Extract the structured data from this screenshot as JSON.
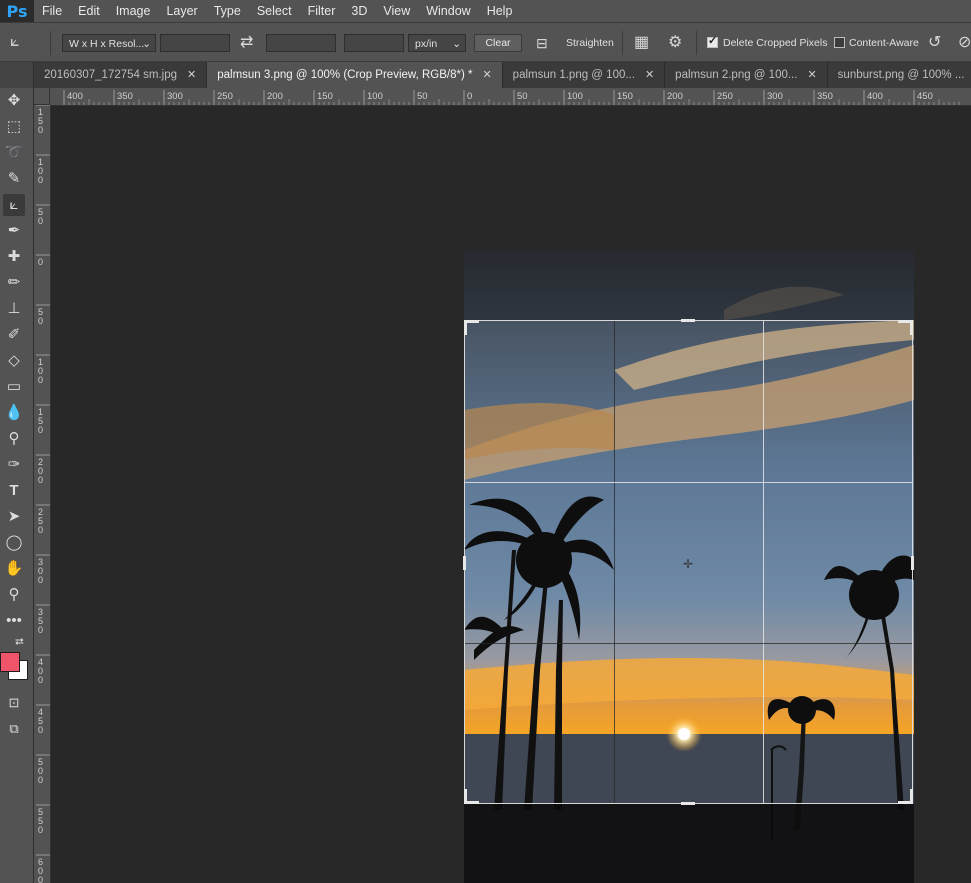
{
  "app": {
    "logo": "Ps"
  },
  "menu": [
    "File",
    "Edit",
    "Image",
    "Layer",
    "Type",
    "Select",
    "Filter",
    "3D",
    "View",
    "Window",
    "Help"
  ],
  "options": {
    "ratio_preset": "W x H x Resol...",
    "unit": "px/in",
    "clear_label": "Clear",
    "straighten_label": "Straighten",
    "delete_cropped_label": "Delete Cropped Pixels",
    "delete_cropped_checked": true,
    "content_aware_label": "Content-Aware",
    "content_aware_checked": false
  },
  "tabs": [
    {
      "label": "20160307_172754 sm.jpg",
      "active": false
    },
    {
      "label": "palmsun 3.png @ 100% (Crop Preview, RGB/8*) *",
      "active": true
    },
    {
      "label": "palmsun 1.png @ 100...",
      "active": false
    },
    {
      "label": "palmsun 2.png @ 100...",
      "active": false
    },
    {
      "label": "sunburst.png @ 100% ...",
      "active": false
    }
  ],
  "close_glyph": "✕",
  "ruler_top_labels": [
    "400",
    "350",
    "300",
    "250",
    "200",
    "150",
    "100",
    "50",
    "0",
    "50",
    "100",
    "150",
    "200",
    "250",
    "300",
    "350",
    "400",
    "450"
  ],
  "ruler_left_labels": [
    "1 5 0",
    "1 0 0",
    "5 0",
    "0",
    "5 0",
    "1 0 0",
    "1 5 0",
    "2 0 0",
    "2 5 0",
    "3 0 0",
    "3 5 0",
    "4 0 0",
    "4 5 0",
    "5 0 0",
    "5 5 0",
    "6 0 0"
  ],
  "colors": {
    "foreground": "#f0546a",
    "background": "#ffffff",
    "accent": "#2fa3f7"
  }
}
